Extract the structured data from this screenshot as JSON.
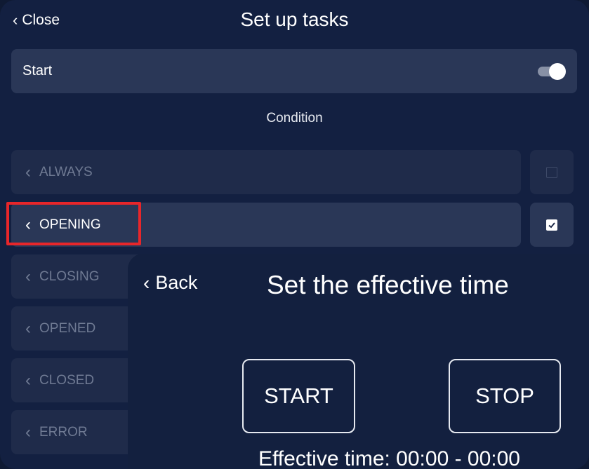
{
  "header": {
    "close_label": "Close",
    "title": "Set up tasks"
  },
  "start": {
    "label": "Start",
    "enabled": true
  },
  "condition_heading": "Condition",
  "conditions": [
    {
      "label": "ALWAYS",
      "checked": false,
      "state": "dim"
    },
    {
      "label": "OPENING",
      "checked": true,
      "state": "active",
      "highlighted": true
    },
    {
      "label": "CLOSING",
      "state": "dim"
    },
    {
      "label": "OPENED",
      "state": "dim"
    },
    {
      "label": "CLOSED",
      "state": "dim"
    },
    {
      "label": "ERROR",
      "state": "dim"
    }
  ],
  "panel": {
    "back_label": "Back",
    "title": "Set the effective time",
    "start_button": "START",
    "stop_button": "STOP",
    "effective_text": "Effective time: 00:00 - 00:00"
  },
  "colors": {
    "background": "#132041",
    "row": "#2a3757",
    "row_dim": "#1f2b4a",
    "highlight": "#e8262a"
  },
  "icons": {
    "back": "chevron-left-icon",
    "checkbox_checked": "checkbox-checked-icon",
    "checkbox_empty": "checkbox-empty-icon"
  }
}
